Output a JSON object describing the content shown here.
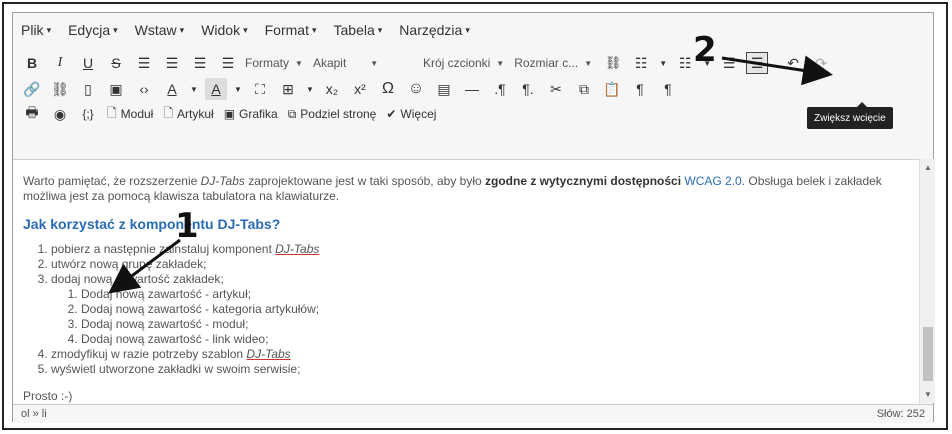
{
  "menubar": {
    "items": [
      {
        "label": "Plik"
      },
      {
        "label": "Edycja"
      },
      {
        "label": "Wstaw"
      },
      {
        "label": "Widok"
      },
      {
        "label": "Format"
      },
      {
        "label": "Tabela"
      },
      {
        "label": "Narzędzia"
      }
    ],
    "caret": "▾"
  },
  "toolbar1": {
    "bold": "B",
    "italic": "I",
    "underline": "U",
    "strike": "S",
    "formaty": "Formaty",
    "akapit": "Akapit",
    "font_family": "Krój czcionki",
    "font_size": "Rozmiar c..."
  },
  "toolbar2": {
    "text_color": "A",
    "bg_color": "A",
    "subscript": "x₂",
    "superscript": "x²",
    "omega": "Ω",
    "emoji": "☺",
    "hr": "—",
    "ltr": "¶",
    "rtl": "¶"
  },
  "toolbar3": {
    "modul": "Moduł",
    "artykul": "Artykuł",
    "grafika": "Grafika",
    "podziel": "Podziel stronę",
    "wiecej": "Więcej"
  },
  "tooltip": "Zwiększ wcięcie",
  "content": {
    "para1_a": "Warto pamiętać, że rozszerzenie ",
    "para1_dj": "DJ-Tabs",
    "para1_b": " zaprojektowane jest w taki sposób, aby było ",
    "para1_bold": "zgodne z wytycznymi dostępności",
    "para1_wcag": " WCAG 2.0.",
    "para1_c": " Obsługa belek i zakładek możliwa jest za pomocą klawisza tabulatora na klawiaturze.",
    "heading": "Jak korzystać z komponentu DJ-Tabs?",
    "list": [
      {
        "text": "pobierz a następnie zainstaluj komponent ",
        "em": "DJ-Tabs"
      },
      {
        "text": "utwórz nową grupę zakładek;",
        "em": ""
      },
      {
        "text": "dodaj nową zawartość zakładek;",
        "em": ""
      },
      {
        "text": "zmodyfikuj w razie potrzeby szablon ",
        "em": "DJ-Tabs"
      },
      {
        "text": "wyświetl utworzone zakładki w swoim serwisie;",
        "em": ""
      }
    ],
    "sublist": [
      "Dodaj nową zawartość - artykuł;",
      "Dodaj nową zawartość - kategoria artykułów;",
      "Dodaj nową zawartość - moduł;",
      "Dodaj nową zawartość - link wideo;"
    ],
    "closing": "Prosto :-)"
  },
  "statusbar": {
    "path": "ol » li",
    "words": "Słów: 252"
  },
  "annotations": {
    "one": "1",
    "two": "2"
  }
}
